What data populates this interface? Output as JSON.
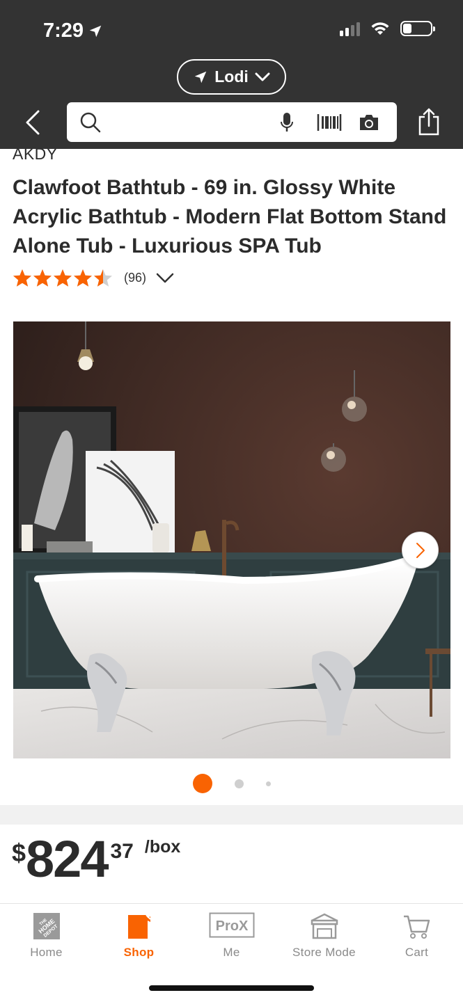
{
  "status_bar": {
    "time": "7:29"
  },
  "header": {
    "location_label": "Lodi",
    "search_placeholder": ""
  },
  "product": {
    "brand": "AKDY",
    "title": "Clawfoot Bathtub - 69 in. Glossy White Acrylic Bathtub - Modern Flat Bottom Stand Alone Tub - Luxurious SPA Tub",
    "rating_value": 4.5,
    "review_count": "(96)",
    "carousel": {
      "total": 3,
      "active": 0
    }
  },
  "price": {
    "currency": "$",
    "dollars": "824",
    "cents": "37",
    "unit": "/box"
  },
  "bottom_nav": [
    {
      "label": "Home",
      "icon": "home-depot-logo-icon",
      "active": false
    },
    {
      "label": "Shop",
      "icon": "shop-bucket-icon",
      "active": true
    },
    {
      "label": "Me",
      "icon": "prox-icon",
      "active": false
    },
    {
      "label": "Store Mode",
      "icon": "store-icon",
      "active": false
    },
    {
      "label": "Cart",
      "icon": "cart-icon",
      "active": false
    }
  ],
  "colors": {
    "accent": "#f96302",
    "header_bg": "#333333",
    "star": "#f96302"
  }
}
